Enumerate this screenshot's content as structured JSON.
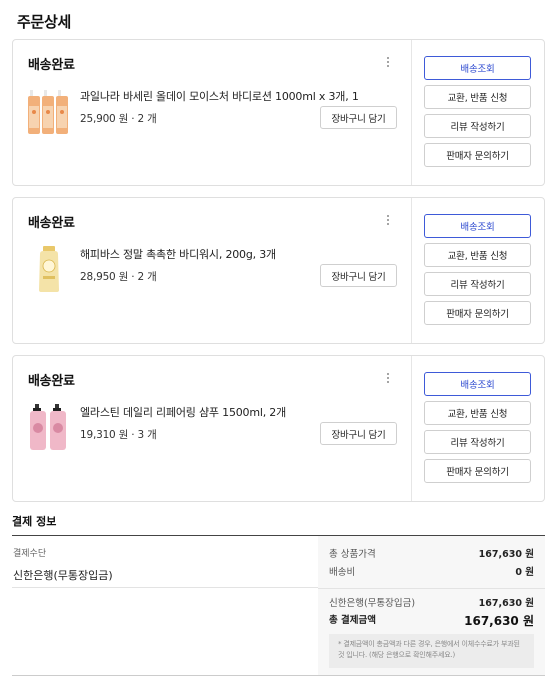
{
  "page": {
    "title": "주문상세"
  },
  "orders": [
    {
      "status": "배송완료",
      "product_name": "과일나라 바세린 올데이 모이스처 바디로션 1000ml x 3개, 1",
      "price_line": "25,900 원 · 2 개",
      "cart_button": "장바구니 담기",
      "thumb_icon": "lotion-bottles-image",
      "actions": [
        "배송조회",
        "교환, 반품 신청",
        "리뷰 작성하기",
        "판매자 문의하기"
      ]
    },
    {
      "status": "배송완료",
      "product_name": "해피바스 정말 촉촉한 바디워시, 200g, 3개",
      "price_line": "28,950 원 · 2 개",
      "cart_button": "장바구니 담기",
      "thumb_icon": "bodywash-bottle-image",
      "actions": [
        "배송조회",
        "교환, 반품 신청",
        "리뷰 작성하기",
        "판매자 문의하기"
      ]
    },
    {
      "status": "배송완료",
      "product_name": "엘라스틴 데일리 리페어링 샴푸 1500ml, 2개",
      "price_line": "19,310 원 · 3 개",
      "cart_button": "장바구니 담기",
      "thumb_icon": "shampoo-bottles-image",
      "actions": [
        "배송조회",
        "교환, 반품 신청",
        "리뷰 작성하기",
        "판매자 문의하기"
      ]
    }
  ],
  "payment": {
    "title": "결제 정보",
    "method_label": "결제수단",
    "method_value": "신한은행(무통장입금)",
    "product_total_label": "총 상품가격",
    "product_total_value": "167,630 원",
    "shipping_label": "배송비",
    "shipping_value": "0 원",
    "bank_label": "신한은행(무통장입금)",
    "bank_value": "167,630 원",
    "grand_total_label": "총 결제금액",
    "grand_total_value": "167,630 원",
    "notice": "* 결제금액이 총금액과 다른 경우, 은행에서 이체수수료가 부과된 것 입니다. (해당 은행으로 확인해주세요.)"
  },
  "colors": {
    "primary_button_border": "#3e5ad8",
    "primary_button_text": "#2f4bd0",
    "card_border": "#dfdfdf",
    "summary_bg": "#f7f7f7"
  }
}
